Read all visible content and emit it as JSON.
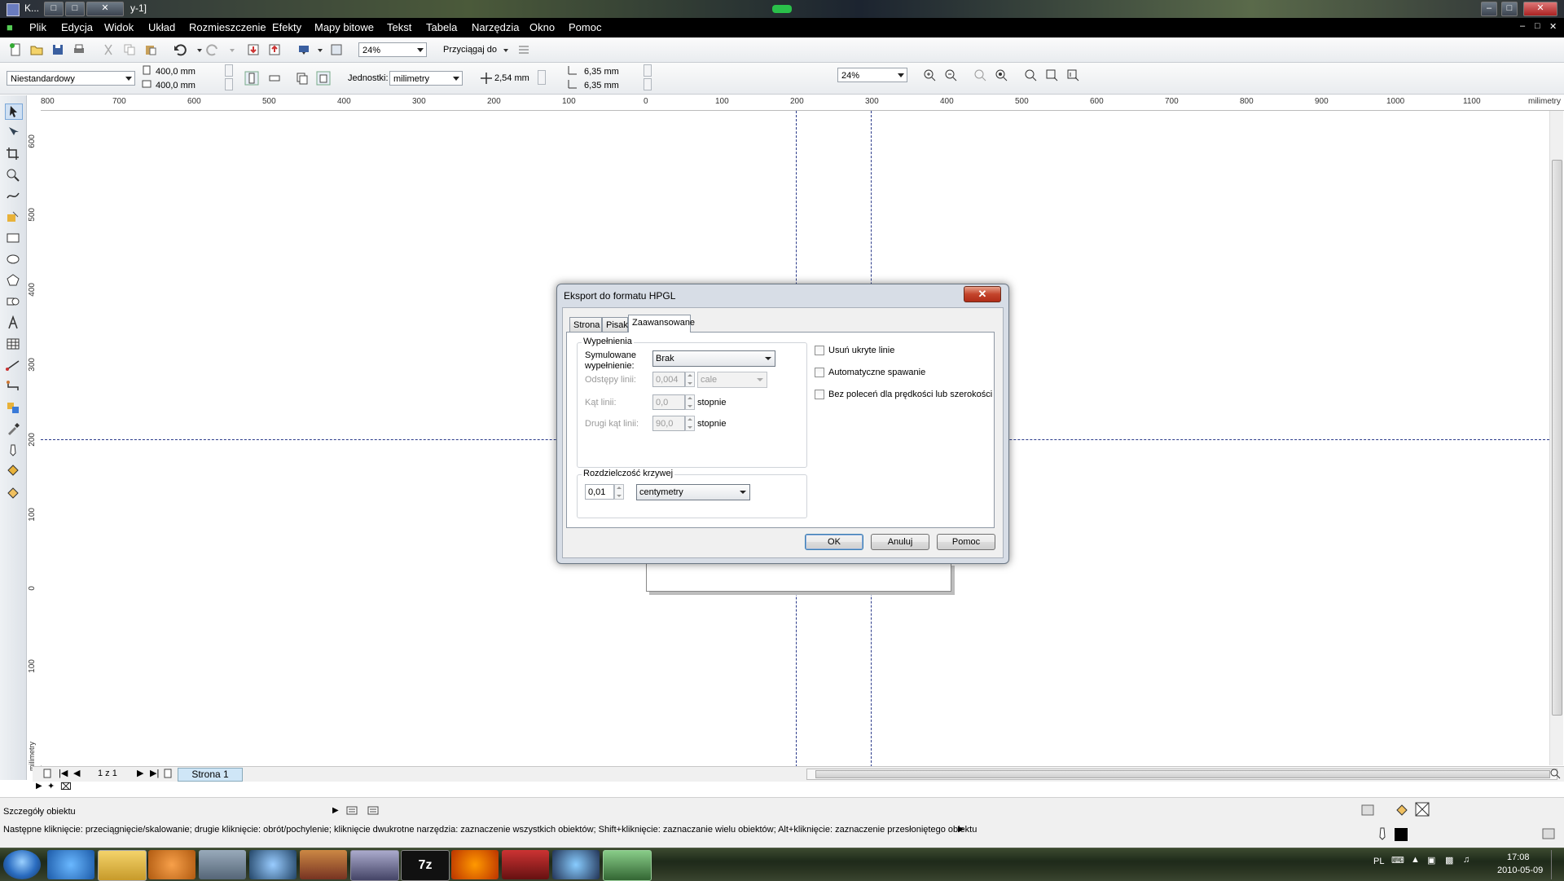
{
  "window": {
    "title_fragment_left": "K...",
    "title_fragment_right": "y-1]",
    "buttons": [
      "–",
      "□",
      "✕"
    ]
  },
  "menu": [
    "Plik",
    "Edycja",
    "Widok",
    "Układ",
    "Rozmieszczenie",
    "Efekty",
    "Mapy bitowe",
    "Tekst",
    "Tabela",
    "Narzędzia",
    "Okno",
    "Pomoc"
  ],
  "standard_toolbar": {
    "zoom": "24%",
    "snap_label": "Przyciągaj do"
  },
  "property_bar": {
    "paper_preset": "Niestandardowy",
    "width": "400,0 mm",
    "height": "400,0 mm",
    "units_label": "Jednostki:",
    "units": "milimetry",
    "nudge": "2,54 mm",
    "dup_x": "6,35 mm",
    "dup_y": "6,35 mm",
    "zoom": "24%"
  },
  "ruler": {
    "h_labels": [
      "800",
      "700",
      "600",
      "500",
      "400",
      "300",
      "200",
      "100",
      "0",
      "100",
      "200",
      "300",
      "400",
      "500",
      "600",
      "700",
      "800",
      "900",
      "1000",
      "1100"
    ],
    "h_unit": "milimetry",
    "v_labels": [
      "600",
      "500",
      "400",
      "300",
      "200",
      "100",
      "0",
      "100"
    ],
    "v_unit": "milimetry"
  },
  "dialog": {
    "title": "Eksport do formatu HPGL",
    "close": "✕",
    "tabs": [
      "Strona",
      "Pisak",
      "Zaawansowane"
    ],
    "fills_group": "Wypełnienia",
    "sim_fill_label": "Symulowane wypełnienie:",
    "sim_fill_value": "Brak",
    "line_spacing_label": "Odstępy linii:",
    "line_spacing_value": "0,004",
    "line_spacing_unit": "cale",
    "line_angle_label": "Kąt linii:",
    "line_angle_value": "0,0",
    "second_angle_label": "Drugi kąt linii:",
    "second_angle_value": "90,0",
    "degrees": "stopnie",
    "curve_group": "Rozdzielczość krzywej",
    "curve_value": "0,01",
    "curve_unit": "centymetry",
    "checkboxes": [
      "Usuń ukryte linie",
      "Automatyczne spawanie",
      "Bez poleceń dla prędkości lub szerokości"
    ],
    "ok": "OK",
    "cancel": "Anuluj",
    "help": "Pomoc"
  },
  "pages": {
    "counter": "1 z 1",
    "page_tab": "Strona 1"
  },
  "status": {
    "object_details": "Szczegóły obiektu",
    "hint": "Następne kliknięcie: przeciągnięcie/skalowanie; drugie kliknięcie: obrót/pochylenie; kliknięcie dwukrotne narzędzia: zaznaczenie wszystkich obiektów; Shift+kliknięcie: zaznaczanie wielu obiektów; Alt+kliknięcie: zaznaczenie przesłoniętego obiektu"
  },
  "taskbar": {
    "lang": "PL",
    "time": "17:08",
    "date": "2010-05-09"
  },
  "colors": {
    "guide": "#2a3a8a",
    "menubar": "#000000",
    "page_tab": "#cfe6f7"
  }
}
